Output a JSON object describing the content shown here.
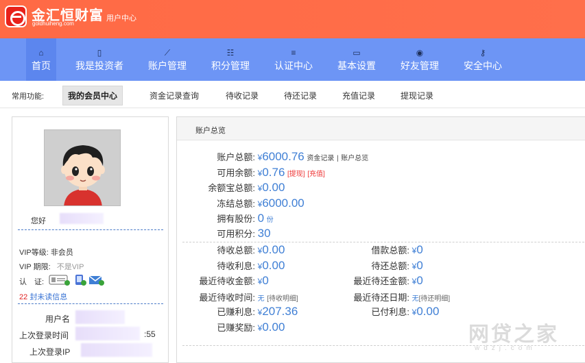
{
  "header": {
    "logo_text": "金汇恒财富",
    "logo_domain": "goldhuiheng.com",
    "subtitle": "用户中心"
  },
  "nav": {
    "items": [
      {
        "label": "首页",
        "icon": "home-icon",
        "glyph": "⌂"
      },
      {
        "label": "我是投资者",
        "icon": "phone-icon",
        "glyph": "▯"
      },
      {
        "label": "账户管理",
        "icon": "chart-icon",
        "glyph": "⟋"
      },
      {
        "label": "积分管理",
        "icon": "gift-icon",
        "glyph": "☷"
      },
      {
        "label": "认证中心",
        "icon": "list-icon",
        "glyph": "≡"
      },
      {
        "label": "基本设置",
        "icon": "monitor-icon",
        "glyph": "▭"
      },
      {
        "label": "好友管理",
        "icon": "user-circle-icon",
        "glyph": "◉"
      },
      {
        "label": "安全中心",
        "icon": "key-icon",
        "glyph": "⚷"
      }
    ]
  },
  "quick": {
    "title": "常用功能:",
    "links": [
      "我的会员中心",
      "资金记录查询",
      "待收记录",
      "待还记录",
      "充值记录",
      "提现记录"
    ]
  },
  "profile": {
    "welcome": "您好",
    "vip_level_label": "VIP等级:",
    "vip_level_value": "非会员",
    "vip_expire_label": "VIP 期限:",
    "vip_expire_value": "不是VIP",
    "verify_label": "认　证:",
    "unread_count": "22",
    "unread_text": "封未读信息",
    "username_label": "用户名",
    "last_login_time_label": "上次登录时间",
    "last_login_time_tail": ":55",
    "last_login_ip_label": "上次登录IP"
  },
  "account": {
    "title": "账户总览",
    "currency": "¥",
    "total_label": "账户总额:",
    "total_value": "6000.76",
    "fund_record_link": "资金记录",
    "separator": "|",
    "account_overview_link": "账户总览",
    "available_label": "可用余额:",
    "available_value": "0.76",
    "withdraw_link": "[提现]",
    "recharge_link": "[充值]",
    "yuebao_label": "余额宝总额:",
    "yuebao_value": "0.00",
    "frozen_label": "冻结总额:",
    "frozen_value": "6000.00",
    "shares_label": "拥有股份:",
    "shares_value": "0",
    "shares_unit": "份",
    "points_label": "可用积分:",
    "points_value": "30",
    "pending_recv_total_label": "待收总额:",
    "pending_recv_total_value": "0.00",
    "pending_recv_interest_label": "待收利息:",
    "pending_recv_interest_value": "0.00",
    "recent_recv_amount_label": "最近待收金额:",
    "recent_recv_amount_value": "0",
    "recent_recv_time_label": "最近待收时间:",
    "recent_recv_time_value": "无",
    "recent_recv_detail_link": "[待收明细]",
    "earned_interest_label": "已赚利息:",
    "earned_interest_value": "207.36",
    "earned_reward_label": "已赚奖励:",
    "earned_reward_value": "0.00",
    "borrow_total_label": "借款总额:",
    "borrow_total_value": "0",
    "pending_repay_total_label": "待还总额:",
    "pending_repay_total_value": "0",
    "recent_repay_amount_label": "最近待还金额:",
    "recent_repay_amount_value": "0",
    "recent_repay_date_label": "最近待还日期:",
    "recent_repay_date_value": "无",
    "recent_repay_detail_link": "[待还明细]",
    "paid_interest_label": "已付利息:",
    "paid_interest_value": "0.00"
  },
  "watermark": {
    "text": "网贷之家",
    "sub": "wdzj.com"
  }
}
